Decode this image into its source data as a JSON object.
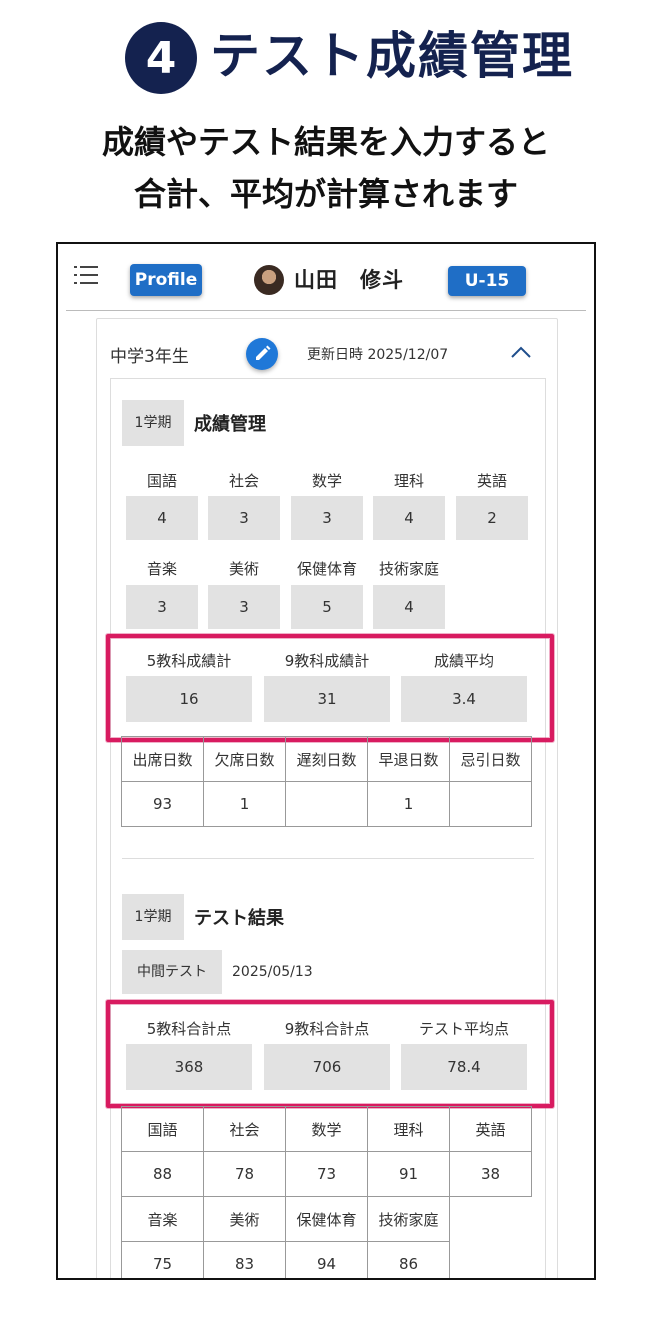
{
  "heading": {
    "number": "4",
    "title": "テスト成績管理"
  },
  "subtitle": {
    "line1": "成績やテスト結果を入力すると",
    "line2": "合計、平均が計算されます"
  },
  "header": {
    "menu_icon": "hamburger-icon",
    "profile_label": "Profile",
    "user_name": "山田　修斗",
    "badge_label": "U-15"
  },
  "record": {
    "grade": "中学3年生",
    "updated": "更新日時 2025/12/07",
    "edit_icon": "pencil-icon",
    "collapse_icon": "chevron-up-icon"
  },
  "grades_section": {
    "term": "1学期",
    "title": "成績管理",
    "row1": [
      {
        "subject": "国語",
        "score": "4"
      },
      {
        "subject": "社会",
        "score": "3"
      },
      {
        "subject": "数学",
        "score": "3"
      },
      {
        "subject": "理科",
        "score": "4"
      },
      {
        "subject": "英語",
        "score": "2"
      }
    ],
    "row2": [
      {
        "subject": "音楽",
        "score": "3"
      },
      {
        "subject": "美術",
        "score": "3"
      },
      {
        "subject": "保健体育",
        "score": "5"
      },
      {
        "subject": "技術家庭",
        "score": "4"
      }
    ],
    "summary": [
      {
        "label": "5教科成績計",
        "value": "16"
      },
      {
        "label": "9教科成績計",
        "value": "31"
      },
      {
        "label": "成績平均",
        "value": "3.4"
      }
    ],
    "attendance_headers": [
      "出席日数",
      "欠席日数",
      "遅刻日数",
      "早退日数",
      "忌引日数"
    ],
    "attendance_values": [
      "93",
      "1",
      "",
      "1",
      ""
    ]
  },
  "test_section": {
    "term": "1学期",
    "title": "テスト結果",
    "test_name": "中間テスト",
    "test_date": "2025/05/13",
    "summary": [
      {
        "label": "5教科合計点",
        "value": "368"
      },
      {
        "label": "9教科合計点",
        "value": "706"
      },
      {
        "label": "テスト平均点",
        "value": "78.4"
      }
    ],
    "row1_headers": [
      "国語",
      "社会",
      "数学",
      "理科",
      "英語"
    ],
    "row1_values": [
      "88",
      "78",
      "73",
      "91",
      "38"
    ],
    "row2_headers": [
      "音楽",
      "美術",
      "保健体育",
      "技術家庭"
    ],
    "row2_values": [
      "75",
      "83",
      "94",
      "86"
    ]
  },
  "colors": {
    "navy": "#14224f",
    "blue": "#1f6ec6",
    "highlight": "#d81b60",
    "box_gray": "#e2e2e2"
  }
}
